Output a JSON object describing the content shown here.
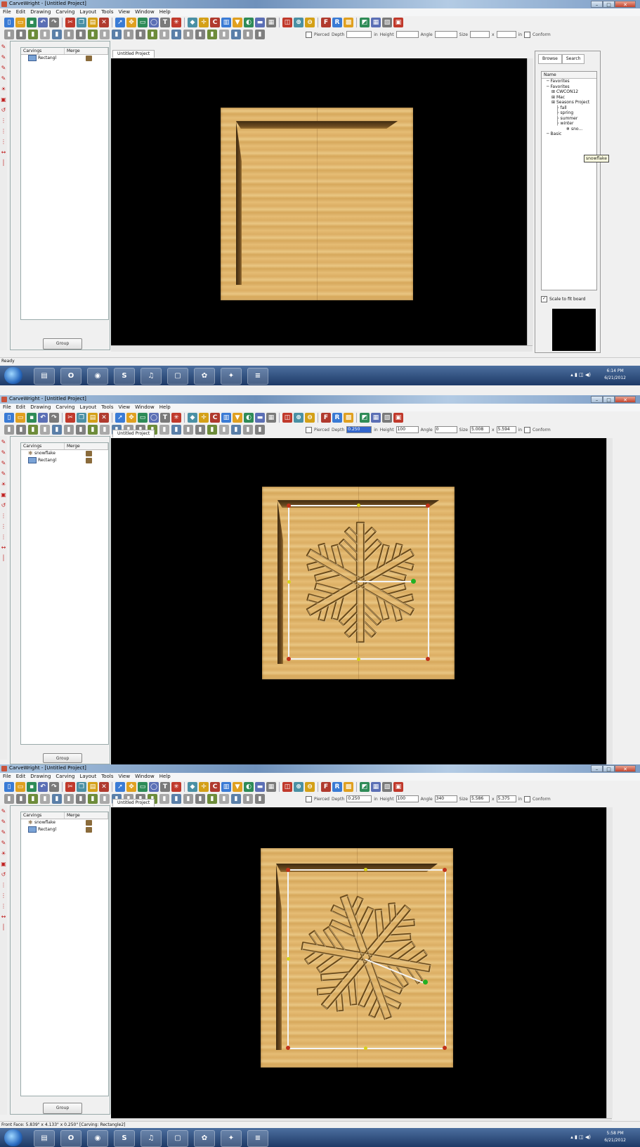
{
  "window": {
    "title": "CarveWright - [Untitled Project]",
    "min": "–",
    "max": "□",
    "close": "✕"
  },
  "menu": [
    "File",
    "Edit",
    "Drawing",
    "Carving",
    "Layout",
    "Tools",
    "View",
    "Window",
    "Help"
  ],
  "toolbar_icons": [
    "new-icon",
    "open-icon",
    "save-icon",
    "undo-icon",
    "redo-icon",
    "cut-icon",
    "copy-icon",
    "paste-icon",
    "delete-icon",
    "select-icon",
    "move-icon",
    "rectangle-icon",
    "ellipse-icon",
    "text-icon",
    "pattern-icon",
    "carve-icon",
    "center-icon",
    "cw-icon",
    "wall-icon",
    "bit-icon",
    "color-icon",
    "tape-icon",
    "board-icon",
    "zoom-fit-icon",
    "zoom-in-icon",
    "zoom-out-icon",
    "font-icon",
    "raised-icon",
    "fill-icon",
    "layout-icon",
    "view2-icon",
    "view3-icon",
    "view4-icon"
  ],
  "props": {
    "pierced": "Pierced",
    "depth_label": "Depth",
    "height_label": "Height",
    "angle_label": "Angle",
    "size_label": "Size",
    "unit": "in",
    "times": "x",
    "conform": "Conform"
  },
  "frames": [
    {
      "depth": "",
      "height": "",
      "angle": "",
      "size_w": "",
      "size_h": "",
      "tab": "Untitled Project",
      "carvings_header": [
        "Carvings",
        "Merge"
      ],
      "carvings": [
        {
          "name": "Rectangl",
          "type": "layer"
        }
      ],
      "group_button": "Group",
      "status": "Ready",
      "clock_time": "6:14 PM",
      "clock_date": "6/21/2012"
    },
    {
      "depth": "0.250",
      "height": "100",
      "angle": "0",
      "size_w": "5.008",
      "size_h": "5.594",
      "tab": "Untitled Project",
      "carvings_header": [
        "Carvings",
        "Merge"
      ],
      "carvings": [
        {
          "name": "snowflake",
          "type": "snow"
        },
        {
          "name": "Rectangl",
          "type": "layer"
        }
      ],
      "group_button": "Group"
    },
    {
      "depth": "0.250",
      "height": "100",
      "angle": "340",
      "size_w": "5.586",
      "size_h": "5.375",
      "tab": "Untitled Project",
      "carvings_header": [
        "Carvings",
        "Merge"
      ],
      "carvings": [
        {
          "name": "snowflake",
          "type": "snow"
        },
        {
          "name": "Rectangl",
          "type": "layer"
        }
      ],
      "group_button": "Group",
      "status": "Front Face: 5.839\" x 4.133\" x 0.250\"  [Carving: Rectangle2]",
      "clock_time": "5:58 PM",
      "clock_date": "6/21/2012"
    }
  ],
  "browser": {
    "tabs": [
      "Browse",
      "Search"
    ],
    "name_header": "Name",
    "tree": [
      {
        "label": "Favorites",
        "indent": 1
      },
      {
        "label": "Favorites",
        "indent": 1
      },
      {
        "label": "CWCON12",
        "indent": 2
      },
      {
        "label": "Mac",
        "indent": 2
      },
      {
        "label": "Seasons Project",
        "indent": 2
      },
      {
        "label": "fall",
        "indent": 3
      },
      {
        "label": "spring",
        "indent": 3
      },
      {
        "label": "summer",
        "indent": 3
      },
      {
        "label": "winter",
        "indent": 3
      },
      {
        "label": "sno...",
        "indent": 5
      },
      {
        "label": "Basic",
        "indent": 1
      }
    ],
    "scale_label": "Scale to fit board",
    "tooltip": "snowflake"
  }
}
